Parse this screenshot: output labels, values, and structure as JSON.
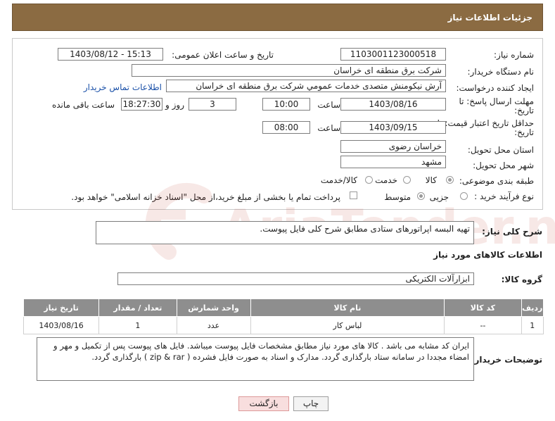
{
  "header": {
    "title": "جزئیات اطلاعات نیاز"
  },
  "form": {
    "need_number_label": "شماره نیاز:",
    "need_number": "1103001123000518",
    "announce_label": "تاریخ و ساعت اعلان عمومی:",
    "announce_value": "1403/08/12 - 15:13",
    "buyer_org_label": "نام دستگاه خریدار:",
    "buyer_org": "شرکت برق منطقه ای خراسان",
    "creator_label": "ایجاد کننده درخواست:",
    "creator": "آرش نیکومنش متصدی خدمات عمومي شرکت برق منطقه ای خراسان",
    "contact_link": "اطلاعات تماس خریدار",
    "deadline_label_1": "مهلت ارسال پاسخ: تا",
    "deadline_label_2": "تاریخ:",
    "deadline_date": "1403/08/16",
    "time_label": "ساعت",
    "deadline_time": "10:00",
    "days_value": "3",
    "days_label": "روز و",
    "remaining_time": "18:27:30",
    "remaining_label": "ساعت باقی مانده",
    "validity_label_1": "حداقل تاریخ اعتبار قیمت: تا",
    "validity_label_2": "تاریخ:",
    "validity_date": "1403/09/15",
    "validity_time": "08:00",
    "province_label": "استان محل تحویل:",
    "province": "خراسان رضوی",
    "city_label": "شهر محل تحویل:",
    "city": "مشهد",
    "category_label": "طبقه بندی موضوعی:",
    "category_options": [
      "کالا",
      "خدمت",
      "کالا/خدمت"
    ],
    "category_selected": "کالا",
    "process_label": "نوع فرآیند خرید :",
    "process_options": [
      "جزیی",
      "متوسط"
    ],
    "process_note": "پرداخت تمام یا بخشی از مبلغ خرید،از محل \"اسناد خزانه اسلامی\" خواهد بود."
  },
  "description": {
    "label": "شرح کلی نیاز:",
    "value": "تهیه البسه اپراتورهای ستادی مطابق شرح کلی فایل پیوست."
  },
  "goods": {
    "title": "اطلاعات کالاهای مورد نیاز",
    "group_label": "گروه کالا:",
    "group_value": "ابزارآلات الکتریکی",
    "columns": [
      "ردیف",
      "کد کالا",
      "نام کالا",
      "واحد شمارش",
      "تعداد / مقدار",
      "تاریخ نیاز"
    ],
    "rows": [
      [
        "1",
        "--",
        "لباس کار",
        "عدد",
        "1",
        "1403/08/16"
      ]
    ]
  },
  "buyer_notes": {
    "label": "توضیحات خریدار:",
    "text": "ایران کد مشابه می باشد . کالا های مورد نیاز مطابق مشخصات فایل پیوست میباشد. فایل های پیوست پس از تکمیل و مهر و امضاء مجددا در سامانه ستاد بارگذاری گردد. مدارک و اسناد به صورت فایل فشرده ( zip & rar ) بارگذاری گردد."
  },
  "buttons": {
    "print": "چاپ",
    "back": "بازگشت"
  },
  "watermark": {
    "text": "AriaTender.net"
  },
  "colors": {
    "header": "#8b6b42",
    "table_header": "#8e8e8e",
    "link": "#1a50a8",
    "back_button": "#f8dede",
    "watermark": "#c0392b"
  }
}
